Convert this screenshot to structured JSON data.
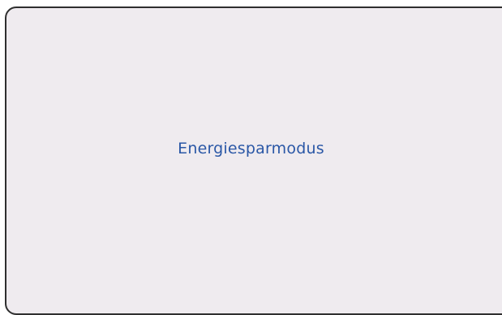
{
  "screen": {
    "status_text": "Energiesparmodus"
  },
  "colors": {
    "background": "#efebef",
    "border": "#2f2f2f",
    "text": "#2a57a6"
  }
}
